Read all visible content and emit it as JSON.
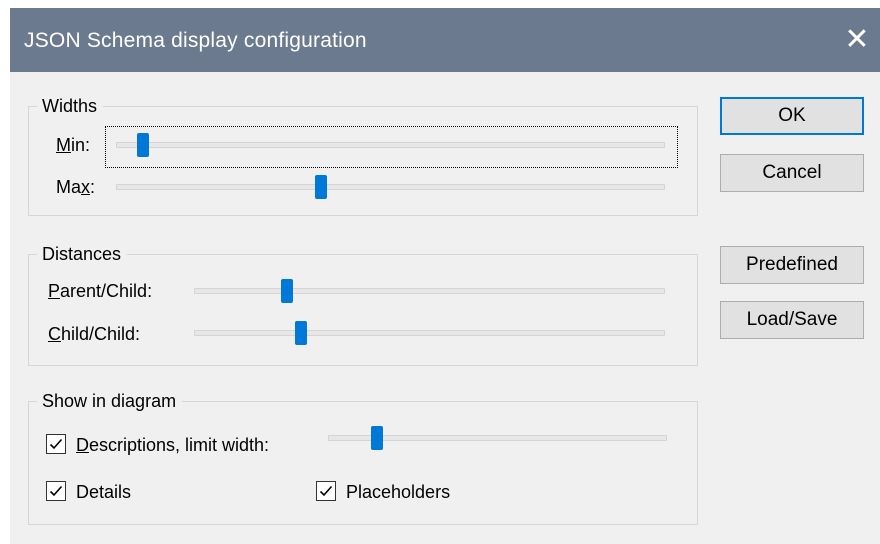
{
  "window": {
    "title": "JSON Schema display configuration",
    "close_glyph": "✕"
  },
  "widths": {
    "legend": "Widths",
    "min": {
      "label_mnemonic": "M",
      "label_rest": "in:",
      "value": 0.04
    },
    "max": {
      "label_start": "Ma",
      "label_mnemonic": "x",
      "label_rest": ":",
      "value": 0.37
    }
  },
  "distances": {
    "legend": "Distances",
    "parent_child": {
      "label_mnemonic": "P",
      "label_rest": "arent/Child:",
      "value": 0.19
    },
    "child_child": {
      "label_mnemonic": "C",
      "label_rest": "hild/Child:",
      "value": 0.22
    }
  },
  "show_in_diagram": {
    "legend": "Show in diagram",
    "descriptions": {
      "label_mnemonic": "D",
      "label_rest": "escriptions, limit width:",
      "checked": true,
      "value": 0.13
    },
    "details": {
      "label": "Details",
      "checked": true
    },
    "placeholders": {
      "label": "Placeholders",
      "checked": true
    }
  },
  "buttons": {
    "ok": "OK",
    "cancel": "Cancel",
    "predefined": "Predefined",
    "load_save": "Load/Save"
  },
  "colors": {
    "title_bar": "#6b7a8f",
    "slider_thumb": "#0078d7",
    "dialog_bg": "#f0f0f0"
  }
}
